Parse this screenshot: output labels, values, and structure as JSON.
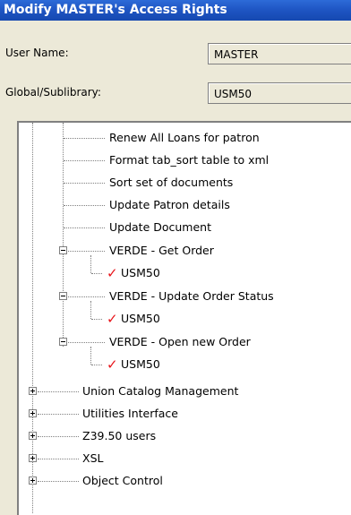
{
  "window": {
    "title": "Modify MASTER's Access Rights"
  },
  "form": {
    "user_name_label": "User Name:",
    "user_name_value": "MASTER",
    "global_label": "Global/Sublibrary:",
    "global_value": "USM50"
  },
  "tree": {
    "children": [
      "Renew All Loans for patron",
      "Format tab_sort table to xml",
      "Sort set of documents",
      "Update Patron details",
      "Update Document"
    ],
    "verde": [
      {
        "label": "VERDE - Get Order",
        "child": "USM50",
        "checked": true
      },
      {
        "label": "VERDE - Update Order Status",
        "child": "USM50",
        "checked": true
      },
      {
        "label": "VERDE - Open new Order",
        "child": "USM50",
        "checked": true
      }
    ],
    "top_level": [
      "Union Catalog Management",
      "Utilities Interface",
      "Z39.50 users",
      "XSL",
      "Object Control"
    ],
    "check_glyph": "✓"
  }
}
